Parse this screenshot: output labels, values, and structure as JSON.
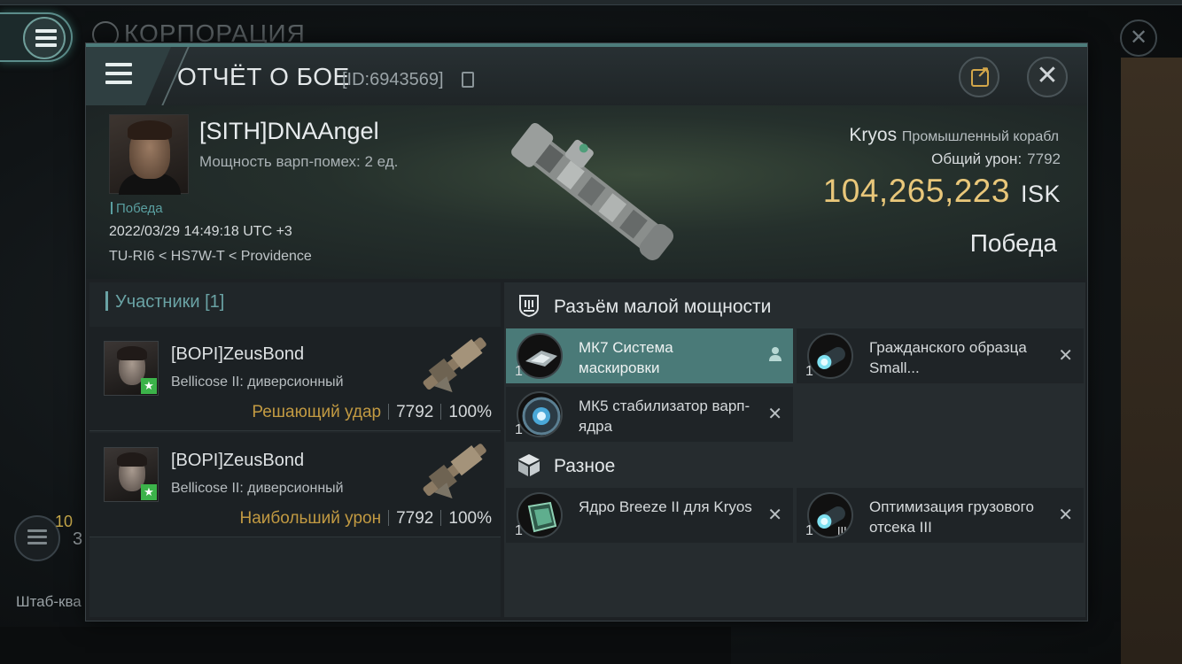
{
  "background": {
    "title": "КОРПОРАЦИЯ",
    "left_small_num": "10",
    "left_big_num": "3",
    "bottom_text": "Штаб-ква"
  },
  "header": {
    "title": "ОТЧЁТ О БОЕ",
    "report_id": "[ID:6943569]"
  },
  "victim": {
    "name": "[SITH]DNAAngel",
    "warp_disrupt": "Мощность варп-помех: 2 ед.",
    "status": "Победа",
    "datetime": "2022/03/29 14:49:18 UTC +3",
    "location": "TU-RI6 < HS7W-T < Providence",
    "ship_name": "Kryos",
    "ship_class": "Промышленный корабл",
    "total_damage_label": "Общий урон:",
    "total_damage": "7792",
    "isk_value": "104,265,223",
    "isk_unit": "ISK",
    "result": "Победа"
  },
  "participants": {
    "header": "Участники [1]",
    "list": [
      {
        "name": "[BOPI]ZeusBond",
        "ship": "Bellicose II: диверсионный",
        "label": "Решающий удар",
        "damage": "7792",
        "percent": "100%"
      },
      {
        "name": "[BOPI]ZeusBond",
        "ship": "Bellicose II: диверсионный",
        "label": "Наибольший урон",
        "damage": "7792",
        "percent": "100%"
      }
    ]
  },
  "modules": {
    "low_slots_header": "Разъём малой мощности",
    "misc_header": "Разное",
    "low_items": [
      {
        "name": "МК7 Система маскировки",
        "qty": "1",
        "state": "selected",
        "icon": "cloak-icon"
      },
      {
        "name": "Гражданского образца Small...",
        "qty": "1",
        "state": "destroyed",
        "icon": "civilian-module-icon"
      },
      {
        "name": "МК5 стабилизатор варп-ядра",
        "qty": "1",
        "state": "destroyed",
        "icon": "warp-core-stabilizer-icon"
      }
    ],
    "misc_items": [
      {
        "name": "Ядро Breeze II для Kryos",
        "qty": "1",
        "state": "destroyed",
        "icon": "ship-core-icon"
      },
      {
        "name": "Оптимизация грузового отсека III",
        "qty": "1",
        "state": "destroyed",
        "icon": "cargo-rig-icon"
      }
    ]
  },
  "colors": {
    "accent": "#5a9fa0",
    "isk": "#e9c77a",
    "highlight_label": "#c29a42",
    "selected_item": "#4a7a78"
  }
}
